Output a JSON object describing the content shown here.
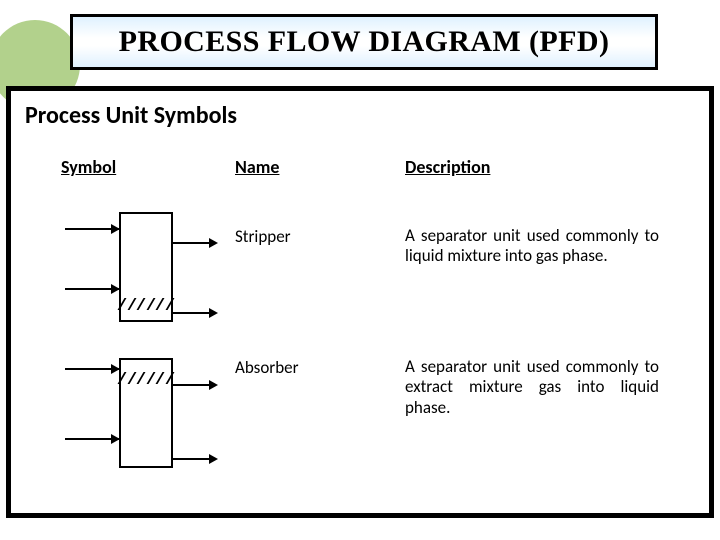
{
  "title": "PROCESS FLOW DIAGRAM (PFD)",
  "section_heading": "Process Unit Symbols",
  "columns": {
    "symbol": "Symbol",
    "name": "Name",
    "description": "Description"
  },
  "rows": [
    {
      "name": "Stripper",
      "description": "A separator unit used commonly to liquid mixture into gas phase."
    },
    {
      "name": "Absorber",
      "description": "A separator unit used commonly to extract mixture gas into liquid phase."
    }
  ]
}
